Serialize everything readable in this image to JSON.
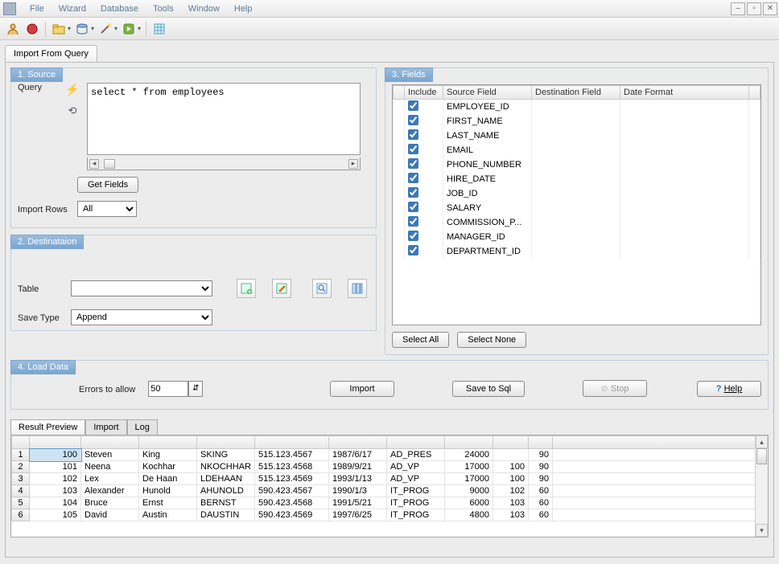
{
  "menu": [
    "File",
    "Wizard",
    "Database",
    "Tools",
    "Window",
    "Help"
  ],
  "tab": "Import From Query",
  "source": {
    "legend": "1. Source",
    "query_label": "Query",
    "query_text": "select * from employees",
    "get_fields": "Get Fields",
    "import_rows_label": "Import Rows",
    "import_rows_value": "All"
  },
  "dest": {
    "legend": "2. Destinataion",
    "table_label": "Table",
    "table_value": "",
    "save_type_label": "Save Type",
    "save_type_value": "Append"
  },
  "fields": {
    "legend": "3. Fields",
    "cols": [
      "Include",
      "Source Field",
      "Destination Field",
      "Date Format"
    ],
    "rows": [
      {
        "inc": true,
        "src": "EMPLOYEE_ID"
      },
      {
        "inc": true,
        "src": "FIRST_NAME"
      },
      {
        "inc": true,
        "src": "LAST_NAME"
      },
      {
        "inc": true,
        "src": "EMAIL"
      },
      {
        "inc": true,
        "src": "PHONE_NUMBER"
      },
      {
        "inc": true,
        "src": "HIRE_DATE"
      },
      {
        "inc": true,
        "src": "JOB_ID"
      },
      {
        "inc": true,
        "src": "SALARY"
      },
      {
        "inc": true,
        "src": "COMMISSION_P..."
      },
      {
        "inc": true,
        "src": "MANAGER_ID"
      },
      {
        "inc": true,
        "src": "DEPARTMENT_ID"
      }
    ],
    "select_all": "Select All",
    "select_none": "Select None"
  },
  "load": {
    "legend": "4. Load Data",
    "errors_label": "Errors to allow",
    "errors_value": "50",
    "import": "Import",
    "save_sql": "Save to Sql",
    "stop": "Stop",
    "help": "Help"
  },
  "result": {
    "tabs": [
      "Result Preview",
      "Import",
      "Log"
    ],
    "rows": [
      [
        "1",
        "100",
        "Steven",
        "King",
        "SKING",
        "515.123.4567",
        "1987/6/17",
        "AD_PRES",
        "24000",
        "",
        "90"
      ],
      [
        "2",
        "101",
        "Neena",
        "Kochhar",
        "NKOCHHAR",
        "515.123.4568",
        "1989/9/21",
        "AD_VP",
        "17000",
        "100",
        "90"
      ],
      [
        "3",
        "102",
        "Lex",
        "De Haan",
        "LDEHAAN",
        "515.123.4569",
        "1993/1/13",
        "AD_VP",
        "17000",
        "100",
        "90"
      ],
      [
        "4",
        "103",
        "Alexander",
        "Hunold",
        "AHUNOLD",
        "590.423.4567",
        "1990/1/3",
        "IT_PROG",
        "9000",
        "102",
        "60"
      ],
      [
        "5",
        "104",
        "Bruce",
        "Ernst",
        "BERNST",
        "590.423.4568",
        "1991/5/21",
        "IT_PROG",
        "6000",
        "103",
        "60"
      ],
      [
        "6",
        "105",
        "David",
        "Austin",
        "DAUSTIN",
        "590.423.4569",
        "1997/6/25",
        "IT_PROG",
        "4800",
        "103",
        "60"
      ]
    ]
  }
}
